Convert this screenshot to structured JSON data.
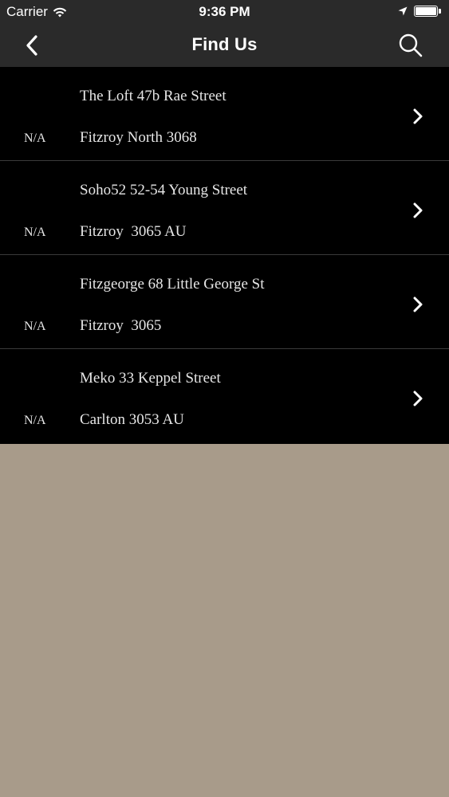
{
  "status_bar": {
    "carrier": "Carrier",
    "time": "9:36 PM",
    "icons": [
      "wifi-icon",
      "location-arrow-icon",
      "battery-icon"
    ]
  },
  "nav": {
    "title": "Find Us",
    "back_icon": "chevron-left-icon",
    "search_icon": "search-icon"
  },
  "colors": {
    "bar_background": "#2a2a2a",
    "row_background": "#000000",
    "page_background": "#a89b8a",
    "text": "#e6e6e6"
  },
  "locations": [
    {
      "name": "The Loft 47b Rae Street",
      "address": "Fitzroy North 3068",
      "distance": "N/A"
    },
    {
      "name": "Soho52 52-54 Young Street",
      "address": "Fitzroy  3065 AU",
      "distance": "N/A"
    },
    {
      "name": "Fitzgeorge 68 Little George St",
      "address": "Fitzroy  3065",
      "distance": "N/A"
    },
    {
      "name": "Meko 33 Keppel Street",
      "address": "Carlton 3053 AU",
      "distance": "N/A"
    }
  ]
}
